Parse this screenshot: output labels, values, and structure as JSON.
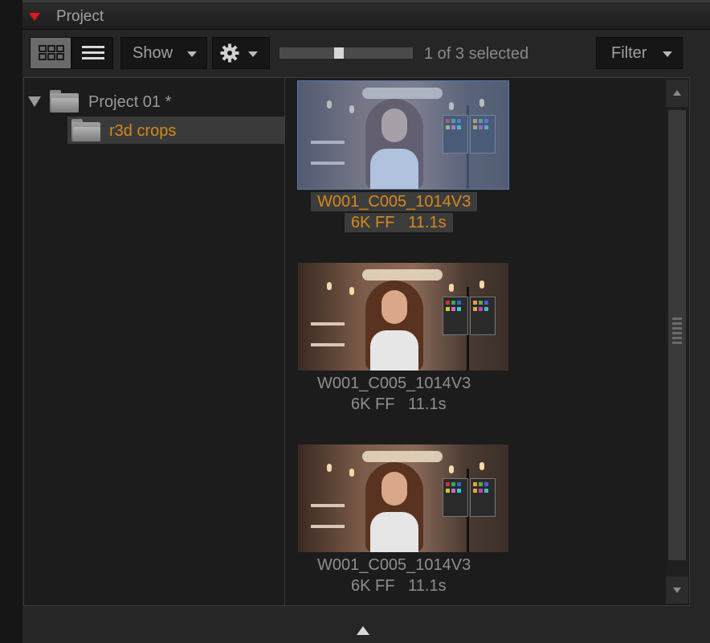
{
  "header": {
    "title": "Project",
    "accent_color": "#e0161a"
  },
  "toolbar": {
    "view_grid_icon": "grid-view-icon",
    "view_list_icon": "list-view-icon",
    "show_label": "Show",
    "settings_icon": "gear-icon",
    "thumbnail_size": 0.5,
    "selection_status": "1 of 3 selected",
    "filter_label": "Filter"
  },
  "tree": {
    "root": {
      "label": "Project 01 *"
    },
    "child": {
      "label": "r3d crops",
      "selected": true,
      "selected_color": "#d6891d"
    }
  },
  "clips": [
    {
      "name": "W001_C005_1014V3",
      "format": "6K FF",
      "duration": "11.1s",
      "selected": true
    },
    {
      "name": "W001_C005_1014V3",
      "format": "6K FF",
      "duration": "11.1s",
      "selected": false
    },
    {
      "name": "W001_C005_1014V3",
      "format": "6K FF",
      "duration": "11.1s",
      "selected": false
    }
  ]
}
